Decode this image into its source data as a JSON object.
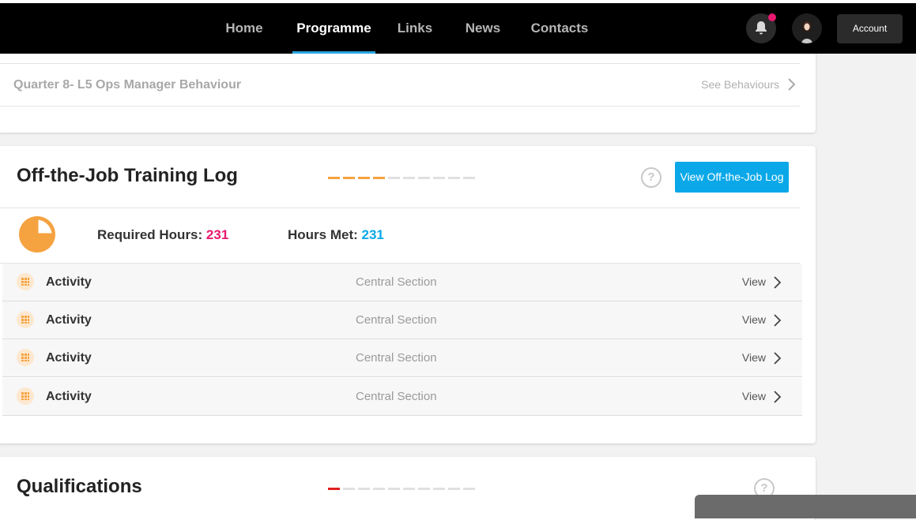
{
  "nav": {
    "items": [
      {
        "label": "Home"
      },
      {
        "label": "Programme"
      },
      {
        "label": "Links"
      },
      {
        "label": "News"
      },
      {
        "label": "Contacts"
      }
    ],
    "active": "Programme",
    "account_label": "Account"
  },
  "colors": {
    "accent_orange": "#f5a240",
    "accent_pink": "#e8196e",
    "accent_blue": "#0aa8e8",
    "qualifications_red": "#e02020"
  },
  "behaviour": {
    "title": "Quarter 8- L5 Ops Manager Behaviour",
    "link_label": "See Behaviours"
  },
  "otj": {
    "title": "Off-the-Job Training Log",
    "progress": {
      "filled": 4,
      "total": 10
    },
    "button_label": "View Off-the-Job Log",
    "help_icon": "question-circle-icon",
    "required_label": "Required Hours:",
    "required_value": "231",
    "met_label": "Hours Met:",
    "met_value": "231",
    "pie_fraction_met": 0.75,
    "activities": [
      {
        "name": "Activity",
        "section": "Central Section",
        "action": "View"
      },
      {
        "name": "Activity",
        "section": "Central Section",
        "action": "View"
      },
      {
        "name": "Activity",
        "section": "Central Section",
        "action": "View"
      },
      {
        "name": "Activity",
        "section": "Central Section",
        "action": "View"
      }
    ]
  },
  "qualifications": {
    "title": "Qualifications",
    "progress": {
      "filled": 1,
      "total": 10
    }
  }
}
